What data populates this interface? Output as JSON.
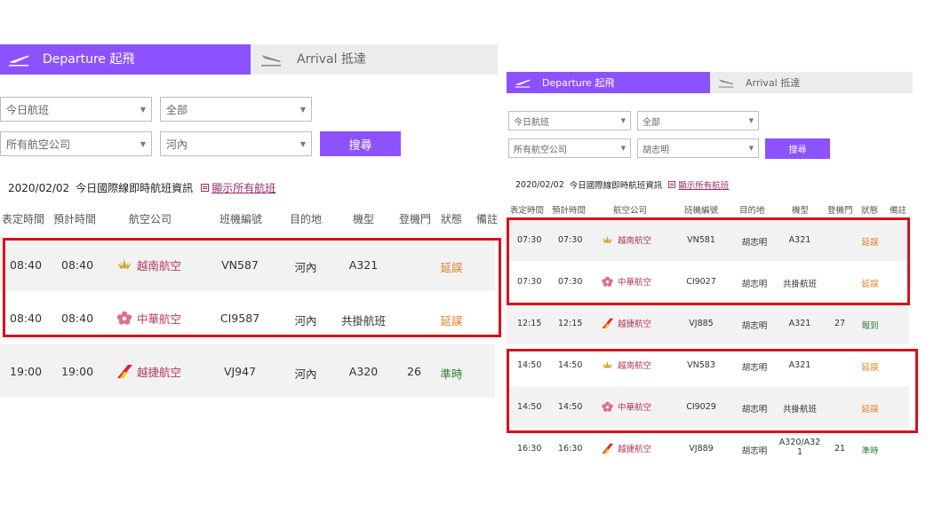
{
  "tabs": {
    "departure_label": "Departure 起飛",
    "arrival_label": "Arrival 抵達"
  },
  "colors": {
    "accent": "#8c52ff",
    "highlight_box": "#d6121b",
    "status_delayed": "#e07b1a",
    "status_ontime": "#2e7d32",
    "airline_text": "#b33a5e"
  },
  "left_panel": {
    "filters": {
      "date_select": "今日航班",
      "terminal_select": "全部",
      "airline_select": "所有航空公司",
      "destination_select": "河內",
      "search_button": "搜尋"
    },
    "info": {
      "date": "2020/02/02",
      "description": "今日國際線即時航班資訊",
      "show_all_link": "顯示所有航班"
    },
    "columns": [
      "表定時間",
      "預計時間",
      "航空公司",
      "班機編號",
      "目的地",
      "機型",
      "登機門",
      "狀態",
      "備註"
    ],
    "flights": [
      {
        "scheduled": "08:40",
        "estimated": "08:40",
        "airline": "越南航空",
        "airline_icon": "lotus-logo-icon",
        "flight": "VN587",
        "destination": "河內",
        "aircraft": "A321",
        "gate": "",
        "status": "延誤",
        "status_type": "delayed"
      },
      {
        "scheduled": "08:40",
        "estimated": "08:40",
        "airline": "中華航空",
        "airline_icon": "plum-blossom-logo-icon",
        "flight": "CI9587",
        "destination": "河內",
        "aircraft": "共掛航班",
        "gate": "",
        "status": "延誤",
        "status_type": "delayed"
      },
      {
        "scheduled": "19:00",
        "estimated": "19:00",
        "airline": "越捷航空",
        "airline_icon": "vietjet-tail-logo-icon",
        "flight": "VJ947",
        "destination": "河內",
        "aircraft": "A320",
        "gate": "26",
        "status": "準時",
        "status_type": "ontime"
      }
    ]
  },
  "right_panel": {
    "filters": {
      "date_select": "今日航班",
      "terminal_select": "全部",
      "airline_select": "所有航空公司",
      "destination_select": "胡志明",
      "search_button": "搜尋"
    },
    "info": {
      "date": "2020/02/02",
      "description": "今日國際線即時航班資訊",
      "show_all_link": "顯示所有航班"
    },
    "columns": [
      "表定時間",
      "預計時間",
      "航空公司",
      "班機編號",
      "目的地",
      "機型",
      "登機門",
      "狀態",
      "備註"
    ],
    "flights": [
      {
        "scheduled": "07:30",
        "estimated": "07:30",
        "airline": "越南航空",
        "airline_icon": "lotus-logo-icon",
        "flight": "VN581",
        "destination": "胡志明",
        "aircraft": "A321",
        "gate": "",
        "status": "延誤",
        "status_type": "delayed"
      },
      {
        "scheduled": "07:30",
        "estimated": "07:30",
        "airline": "中華航空",
        "airline_icon": "plum-blossom-logo-icon",
        "flight": "CI9027",
        "destination": "胡志明",
        "aircraft": "共掛航班",
        "gate": "",
        "status": "延誤",
        "status_type": "delayed"
      },
      {
        "scheduled": "12:15",
        "estimated": "12:15",
        "airline": "越捷航空",
        "airline_icon": "vietjet-tail-logo-icon",
        "flight": "VJ885",
        "destination": "胡志明",
        "aircraft": "A321",
        "gate": "27",
        "status": "報到",
        "status_type": "ontime"
      },
      {
        "scheduled": "14:50",
        "estimated": "14:50",
        "airline": "越南航空",
        "airline_icon": "lotus-logo-icon",
        "flight": "VN583",
        "destination": "胡志明",
        "aircraft": "A321",
        "gate": "",
        "status": "延誤",
        "status_type": "delayed"
      },
      {
        "scheduled": "14:50",
        "estimated": "14:50",
        "airline": "中華航空",
        "airline_icon": "plum-blossom-logo-icon",
        "flight": "CI9029",
        "destination": "胡志明",
        "aircraft": "共掛航班",
        "gate": "",
        "status": "延誤",
        "status_type": "delayed"
      },
      {
        "scheduled": "16:30",
        "estimated": "16:30",
        "airline": "越捷航空",
        "airline_icon": "vietjet-tail-logo-icon",
        "flight": "VJ889",
        "destination": "胡志明",
        "aircraft": "A320/A321",
        "gate": "21",
        "status": "準時",
        "status_type": "ontime"
      }
    ]
  }
}
